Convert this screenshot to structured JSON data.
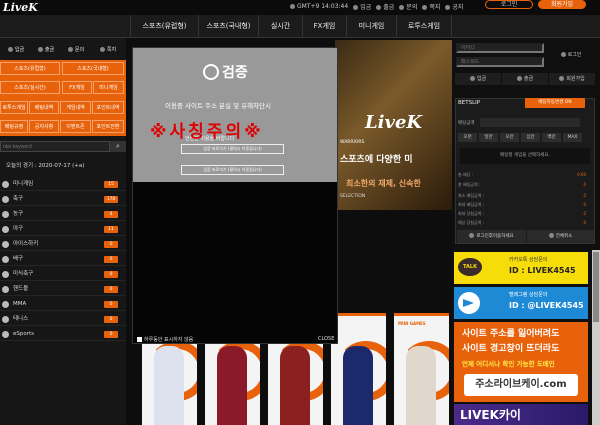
{
  "header": {
    "logo": "LiveK",
    "gmt": "GMT+9 14:03:44",
    "links": [
      "입금",
      "출금",
      "문의",
      "쪽지",
      "공지"
    ],
    "login": "로그인",
    "join": "회원가입"
  },
  "nav": [
    "스포츠(유럽형)",
    "스포츠(국내형)",
    "실시간",
    "FX게임",
    "미니게임",
    "로투스게임"
  ],
  "left": {
    "top_buttons": [
      "입금",
      "출금",
      "문의",
      "쪽지"
    ],
    "grid": [
      "스포츠(유럽형)",
      "스포츠(국내형)",
      "스포츠(실시간)",
      "FX게임",
      "미니게임",
      "로투스게임",
      "배팅내역",
      "게임내역",
      "포인트내역",
      "배팅규정",
      "공지사항",
      "이벤트존",
      "포인트전환"
    ],
    "search_placeholder": "nter keyword",
    "today": "오늘의 경기 : 2020-07-17 (+a)",
    "sports": [
      {
        "name": "미니게임",
        "count": "15"
      },
      {
        "name": "축구",
        "count": "178"
      },
      {
        "name": "농구",
        "count": "4"
      },
      {
        "name": "야구",
        "count": "11"
      },
      {
        "name": "아이스하키",
        "count": "0"
      },
      {
        "name": "배구",
        "count": "0"
      },
      {
        "name": "미식축구",
        "count": "0"
      },
      {
        "name": "핸드볼",
        "count": "0"
      },
      {
        "name": "MMA",
        "count": "0"
      },
      {
        "name": "테니스",
        "count": "0"
      },
      {
        "name": "eSports",
        "count": "0"
      }
    ]
  },
  "popup": {
    "brand": "검증",
    "line1": "이용중 사이트 주소 분실 및 유해차단시",
    "warning": "※사칭주의※",
    "line2": "안전한 이용을 바랍니다",
    "btn1": "검증 바로가기 (클릭시 이동됩니다)",
    "btn2": "검증 바로가기 (클릭시 이동됩니다)",
    "no_show": "하루동안 표시하지 않음",
    "close": "CLOSE"
  },
  "banner": {
    "logo": "LiveK",
    "headline": "스포츠에 다양한 미",
    "sub": "최소한의 재제, 신속한",
    "small": "WARRIORS",
    "small2": "SELECTION"
  },
  "cards": [
    {
      "title": ""
    },
    {
      "title": ""
    },
    {
      "title": "SPORTS"
    },
    {
      "title": ""
    },
    {
      "title": "MINI GAMES"
    }
  ],
  "right": {
    "id_placeholder": "아이디",
    "pw_placeholder": "패스워드",
    "login": "로그인",
    "tabs": [
      "입금",
      "출금",
      "회원가입"
    ],
    "betslip": {
      "title": "BETSLIP",
      "toggle": "배당자동변경 ON",
      "amount_label": "배팅금액",
      "chips": [
        "오천",
        "일만",
        "오만",
        "십만",
        "백만",
        "MAX"
      ],
      "message": "배팅할 게임을 선택하세요.",
      "rows": [
        {
          "label": "총 배당 :",
          "value": "0.00"
        },
        {
          "label": "총 배팅금액 :",
          "value": "0"
        },
        {
          "label": "최소 배팅금액 :",
          "value": "0"
        },
        {
          "label": "최대 배팅금액 :",
          "value": "0"
        },
        {
          "label": "최대 당첨금액 :",
          "value": "0"
        },
        {
          "label": "예상 당첨금액 :",
          "value": "0"
        }
      ],
      "btn_bet": "로그인후이용하세요",
      "btn_cancel": "전체취소"
    },
    "kakao": {
      "badge": "TALK",
      "line1": "카카오톡 상담문의",
      "line2": "ID : LIVEK4545"
    },
    "telegram": {
      "line1": "텔레그램 상담문의",
      "line2": "ID : @LIVEK4545"
    },
    "addr": {
      "t1": "사이트 주소를 잃어버려도",
      "t2": "사이트 경고창이 뜨더라도",
      "t3": "언제 어디서나 확인 가능한 도메인",
      "t4": "주소라이브케이.com"
    },
    "livek2": "LIVEK카이"
  },
  "colors": {
    "accent": "#e8620c",
    "kakao": "#f6dd0a",
    "telegram": "#1e8ad6",
    "warning": "#e00000"
  }
}
